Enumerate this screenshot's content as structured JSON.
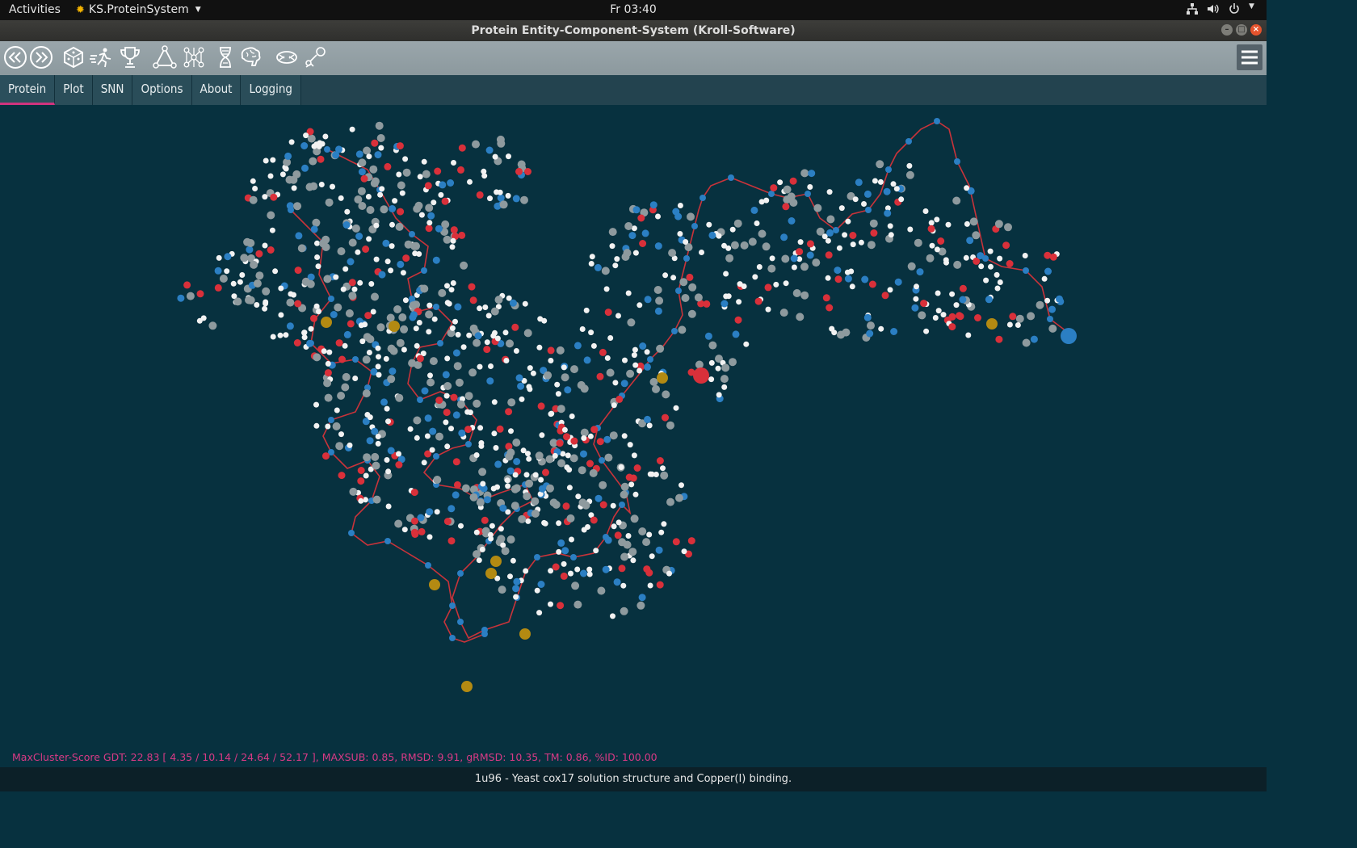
{
  "topbar": {
    "activities": "Activities",
    "app_name": "KS.ProteinSystem",
    "clock": "Fr 03:40",
    "tray_icons": [
      "network-icon",
      "volume-icon",
      "power-icon"
    ]
  },
  "window": {
    "title": "Protein Entity-Component-System (Kroll-Software)"
  },
  "toolbar": {
    "icons": [
      "back-icon",
      "forward-icon",
      "dice-icon",
      "runner-icon",
      "trophy-icon",
      "triangle-nodes-icon",
      "network-graph-icon",
      "hourglass-icon",
      "brain-icon",
      "neuron-icon",
      "satellite-icon"
    ]
  },
  "tabs": [
    "Protein",
    "Plot",
    "SNN",
    "Options",
    "About",
    "Logging"
  ],
  "active_tab": "Protein",
  "viewport": {
    "colors": {
      "background": "#07313f",
      "backbone": "#c9333a",
      "atom_red": "#d9303a",
      "atom_blue": "#2b7fc3",
      "atom_white": "#f2f2f2",
      "atom_grey": "#8e9a9e",
      "atom_gold": "#b38a12"
    }
  },
  "score_line": "MaxCluster-Score GDT: 22.83  [ 4.35 / 10.14 / 24.64 / 52.17 ], MAXSUB: 0.85, RMSD: 9.91, gRMSD: 10.35, TM: 0.86, %ID: 100.00",
  "status": "1u96 - Yeast cox17 solution structure and Copper(I) binding."
}
